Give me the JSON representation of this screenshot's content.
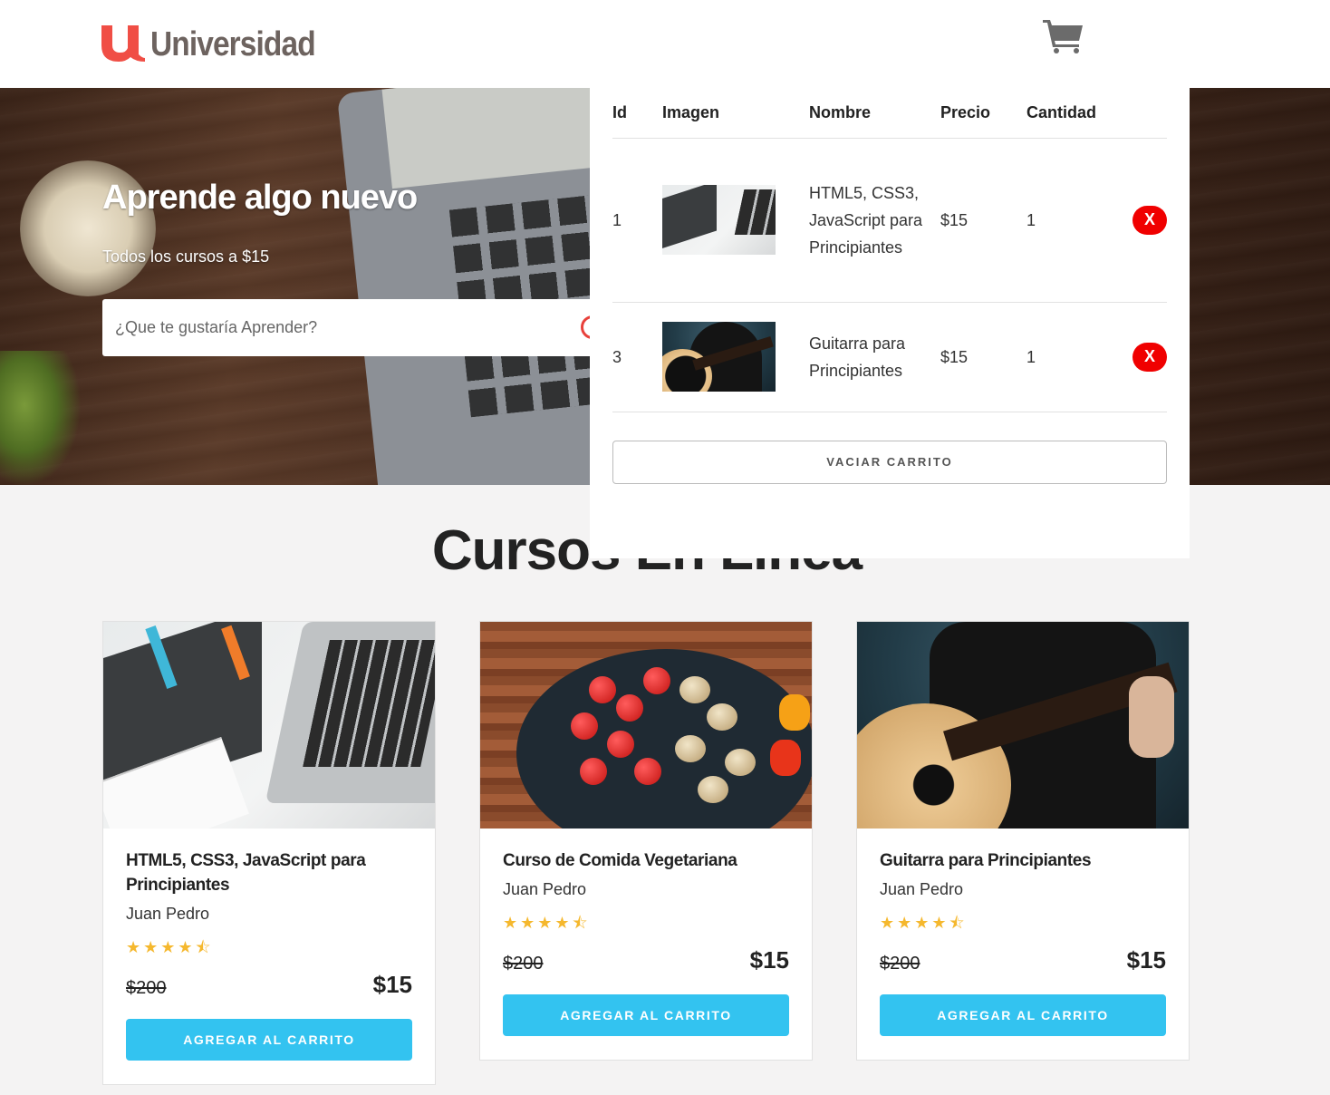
{
  "header": {
    "logo_text": "Universidad",
    "brand_color": "#f04e45"
  },
  "hero": {
    "title": "Aprende algo nuevo",
    "subtitle": "Todos los cursos a $15",
    "search_placeholder": "¿Que te gustaría Aprender?"
  },
  "cart": {
    "columns": [
      "Id",
      "Imagen",
      "Nombre",
      "Precio",
      "Cantidad"
    ],
    "items": [
      {
        "id": "1",
        "name": "HTML5, CSS3, JavaScript para Principiantes",
        "price": "$15",
        "quantity": "1",
        "image": "html-css-course-thumbnail",
        "remove_label": "X"
      },
      {
        "id": "3",
        "name": "Guitarra para Principiantes",
        "price": "$15",
        "quantity": "1",
        "image": "guitar-course-thumbnail",
        "remove_label": "X"
      }
    ],
    "empty_label": "VACIAR CARRITO"
  },
  "section_title": "Cursos En Línea",
  "courses": [
    {
      "title": "HTML5, CSS3, JavaScript para Principiantes",
      "author": "Juan Pedro",
      "rating_stars": 4.5,
      "old_price": "$200",
      "price": "$15",
      "button_label": "AGREGAR AL CARRITO",
      "image": "html-css-laptop-image"
    },
    {
      "title": "Curso de Comida Vegetariana",
      "author": "Juan Pedro",
      "rating_stars": 4.5,
      "old_price": "$200",
      "price": "$15",
      "button_label": "AGREGAR AL CARRITO",
      "image": "vegetable-pan-image"
    },
    {
      "title": "Guitarra para Principiantes",
      "author": "Juan Pedro",
      "rating_stars": 4.5,
      "old_price": "$200",
      "price": "$15",
      "button_label": "AGREGAR AL CARRITO",
      "image": "guitar-player-image"
    }
  ],
  "colors": {
    "button_blue": "#33c3f0",
    "remove_red": "#f00000",
    "star_gold": "#f5b82e"
  }
}
